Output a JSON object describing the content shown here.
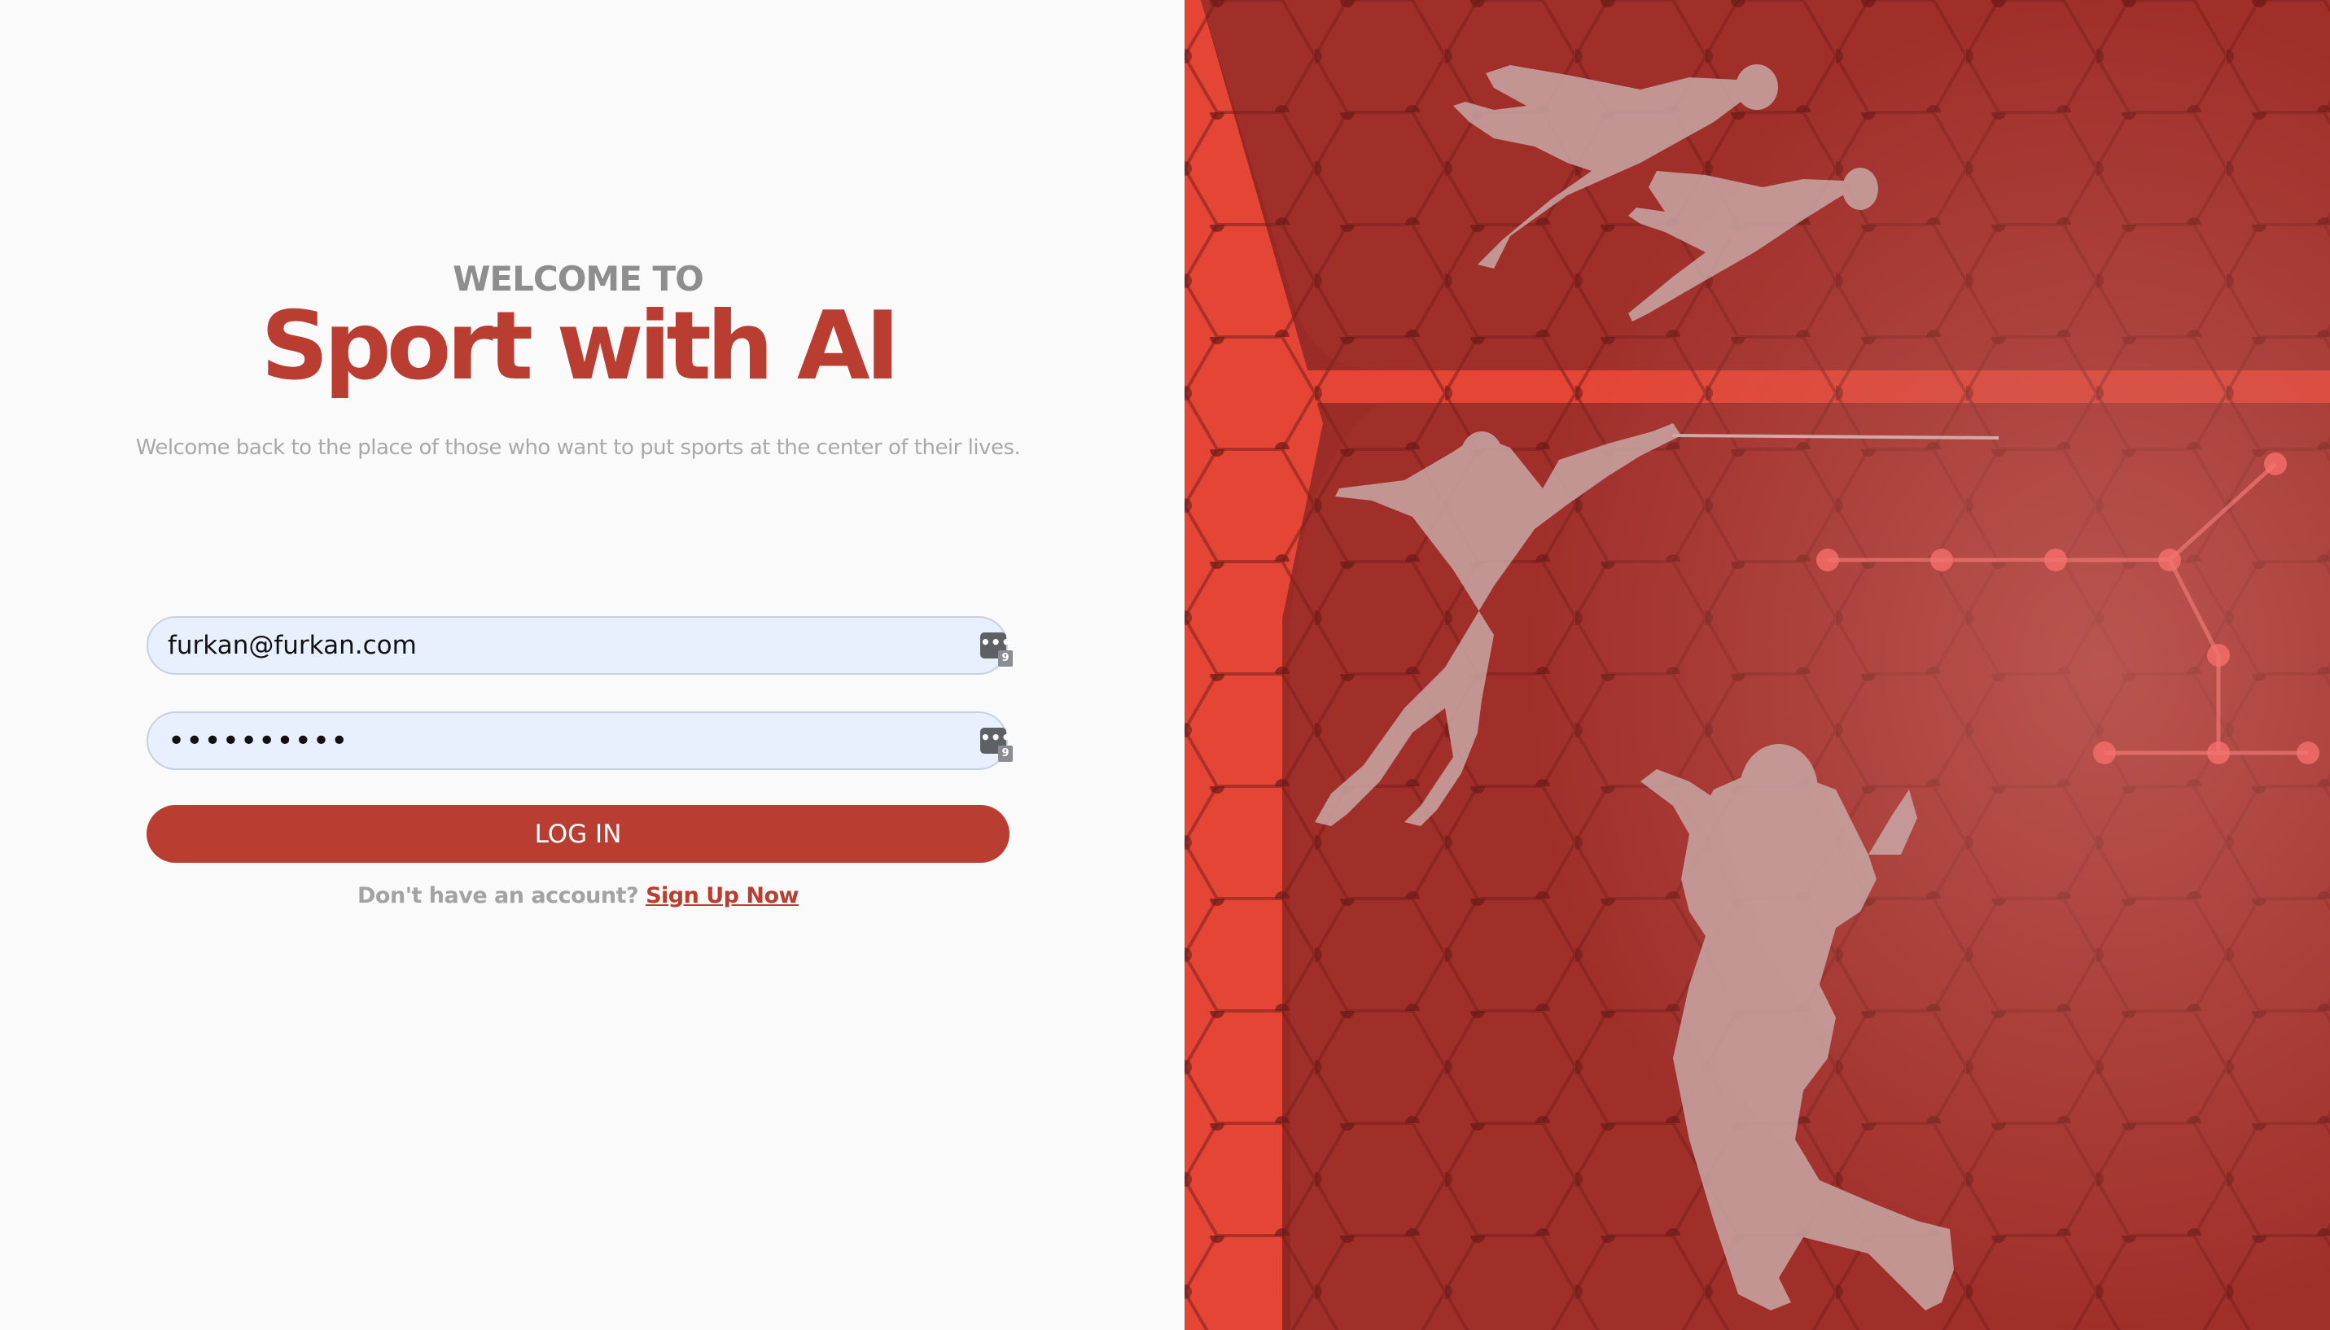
{
  "welcome": {
    "pre_title": "WELCOME TO",
    "title": "Sport with AI",
    "tagline": "Welcome back to the place of those who want to put sports at the center of their lives."
  },
  "form": {
    "email_value": "furkan@furkan.com",
    "password_value": "••••••••••",
    "password_manager_count": "9",
    "password_manager_icon": "password-manager-icon",
    "login_label": "LOG IN"
  },
  "signup": {
    "prompt": "Don't have an account?",
    "link": "Sign Up Now"
  },
  "colors": {
    "brand": "#b93d30",
    "hero_background": "#a6302b",
    "input_fill": "#e8f0fe"
  }
}
